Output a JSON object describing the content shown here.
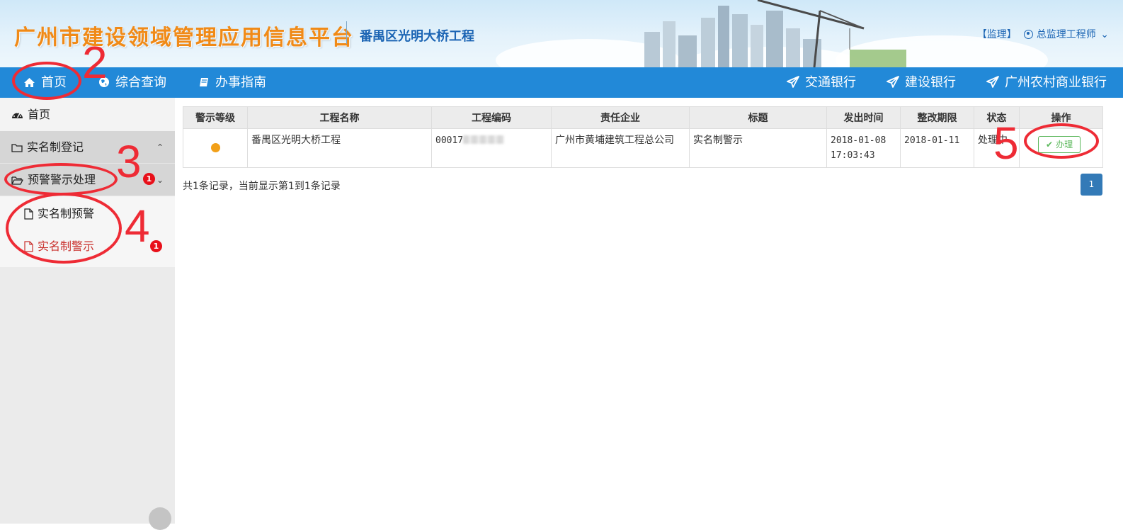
{
  "header": {
    "title": "广州市建设领域管理应用信息平台",
    "project": "番禺区光明大桥工程",
    "role": "【监理】",
    "user": "总监理工程师",
    "user_caret": "⌄"
  },
  "nav": {
    "items": [
      {
        "label": "首页",
        "icon": "home-icon"
      },
      {
        "label": "综合查询",
        "icon": "globe-icon"
      },
      {
        "label": "办事指南",
        "icon": "book-icon"
      }
    ],
    "banks": [
      {
        "label": "交通银行",
        "icon": "send-icon"
      },
      {
        "label": "建设银行",
        "icon": "send-icon"
      },
      {
        "label": "广州农村商业银行",
        "icon": "send-icon"
      }
    ]
  },
  "sidebar": {
    "home": "首页",
    "groups": [
      {
        "label": "实名制登记",
        "chevron": "⌃"
      },
      {
        "label": "预警警示处理",
        "chevron": "⌄",
        "badge": "1"
      }
    ],
    "subitems": [
      {
        "label": "实名制预警"
      },
      {
        "label": "实名制警示",
        "badge": "1",
        "active": true
      }
    ]
  },
  "table": {
    "columns": [
      "警示等级",
      "工程名称",
      "工程编码",
      "责任企业",
      "标题",
      "发出时间",
      "整改期限",
      "状态",
      "操作"
    ],
    "rows": [
      {
        "level_color": "#f2a019",
        "project": "番禺区光明大桥工程",
        "code_prefix": "00017",
        "company": "广州市黄埔建筑工程总公司",
        "title": "实名制警示",
        "issued": "2018-01-08 17:03:43",
        "deadline": "2018-01-11",
        "status": "处理中",
        "action": "办理"
      }
    ]
  },
  "footer": {
    "summary": "共1条记录，当前显示第1到1条记录",
    "page": "1"
  },
  "annotations": [
    "2",
    "3",
    "4",
    "5"
  ],
  "colors": {
    "nav": "#2289d8",
    "title": "#f08a17",
    "annotation": "#ee2b35",
    "badge": "#e8101a"
  }
}
